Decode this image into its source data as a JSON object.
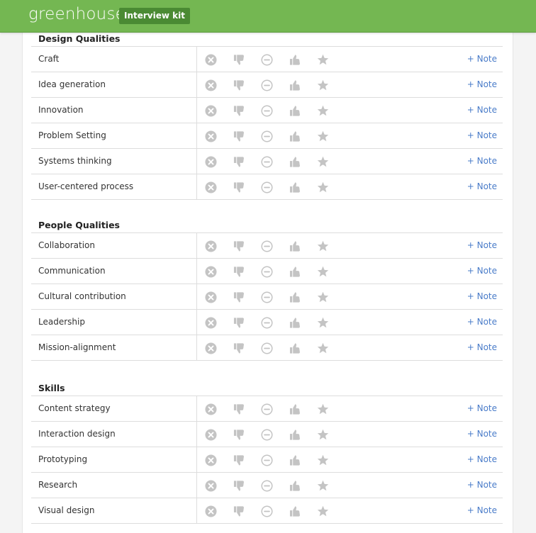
{
  "header": {
    "logo": "greenhouse",
    "badge": "Interview kit"
  },
  "icons": [
    "close-circle-icon",
    "thumbs-down-icon",
    "minus-circle-icon",
    "thumbs-up-icon",
    "star-icon"
  ],
  "note_label": "+ Note",
  "sections": [
    {
      "title": "Design Qualities",
      "items": [
        "Craft",
        "Idea generation",
        "Innovation",
        "Problem Setting",
        "Systems thinking",
        "User-centered process"
      ]
    },
    {
      "title": "People Qualities",
      "items": [
        "Collaboration",
        "Communication",
        "Cultural contribution",
        "Leadership",
        "Mission-alignment"
      ]
    },
    {
      "title": "Skills",
      "items": [
        "Content strategy",
        "Interaction design",
        "Prototyping",
        "Research",
        "Visual design"
      ]
    }
  ],
  "colors": {
    "header_green": "#74b752",
    "badge_green": "#4a8a33",
    "icon_gray": "#c4c4c4",
    "link_blue": "#4a7cc9"
  }
}
